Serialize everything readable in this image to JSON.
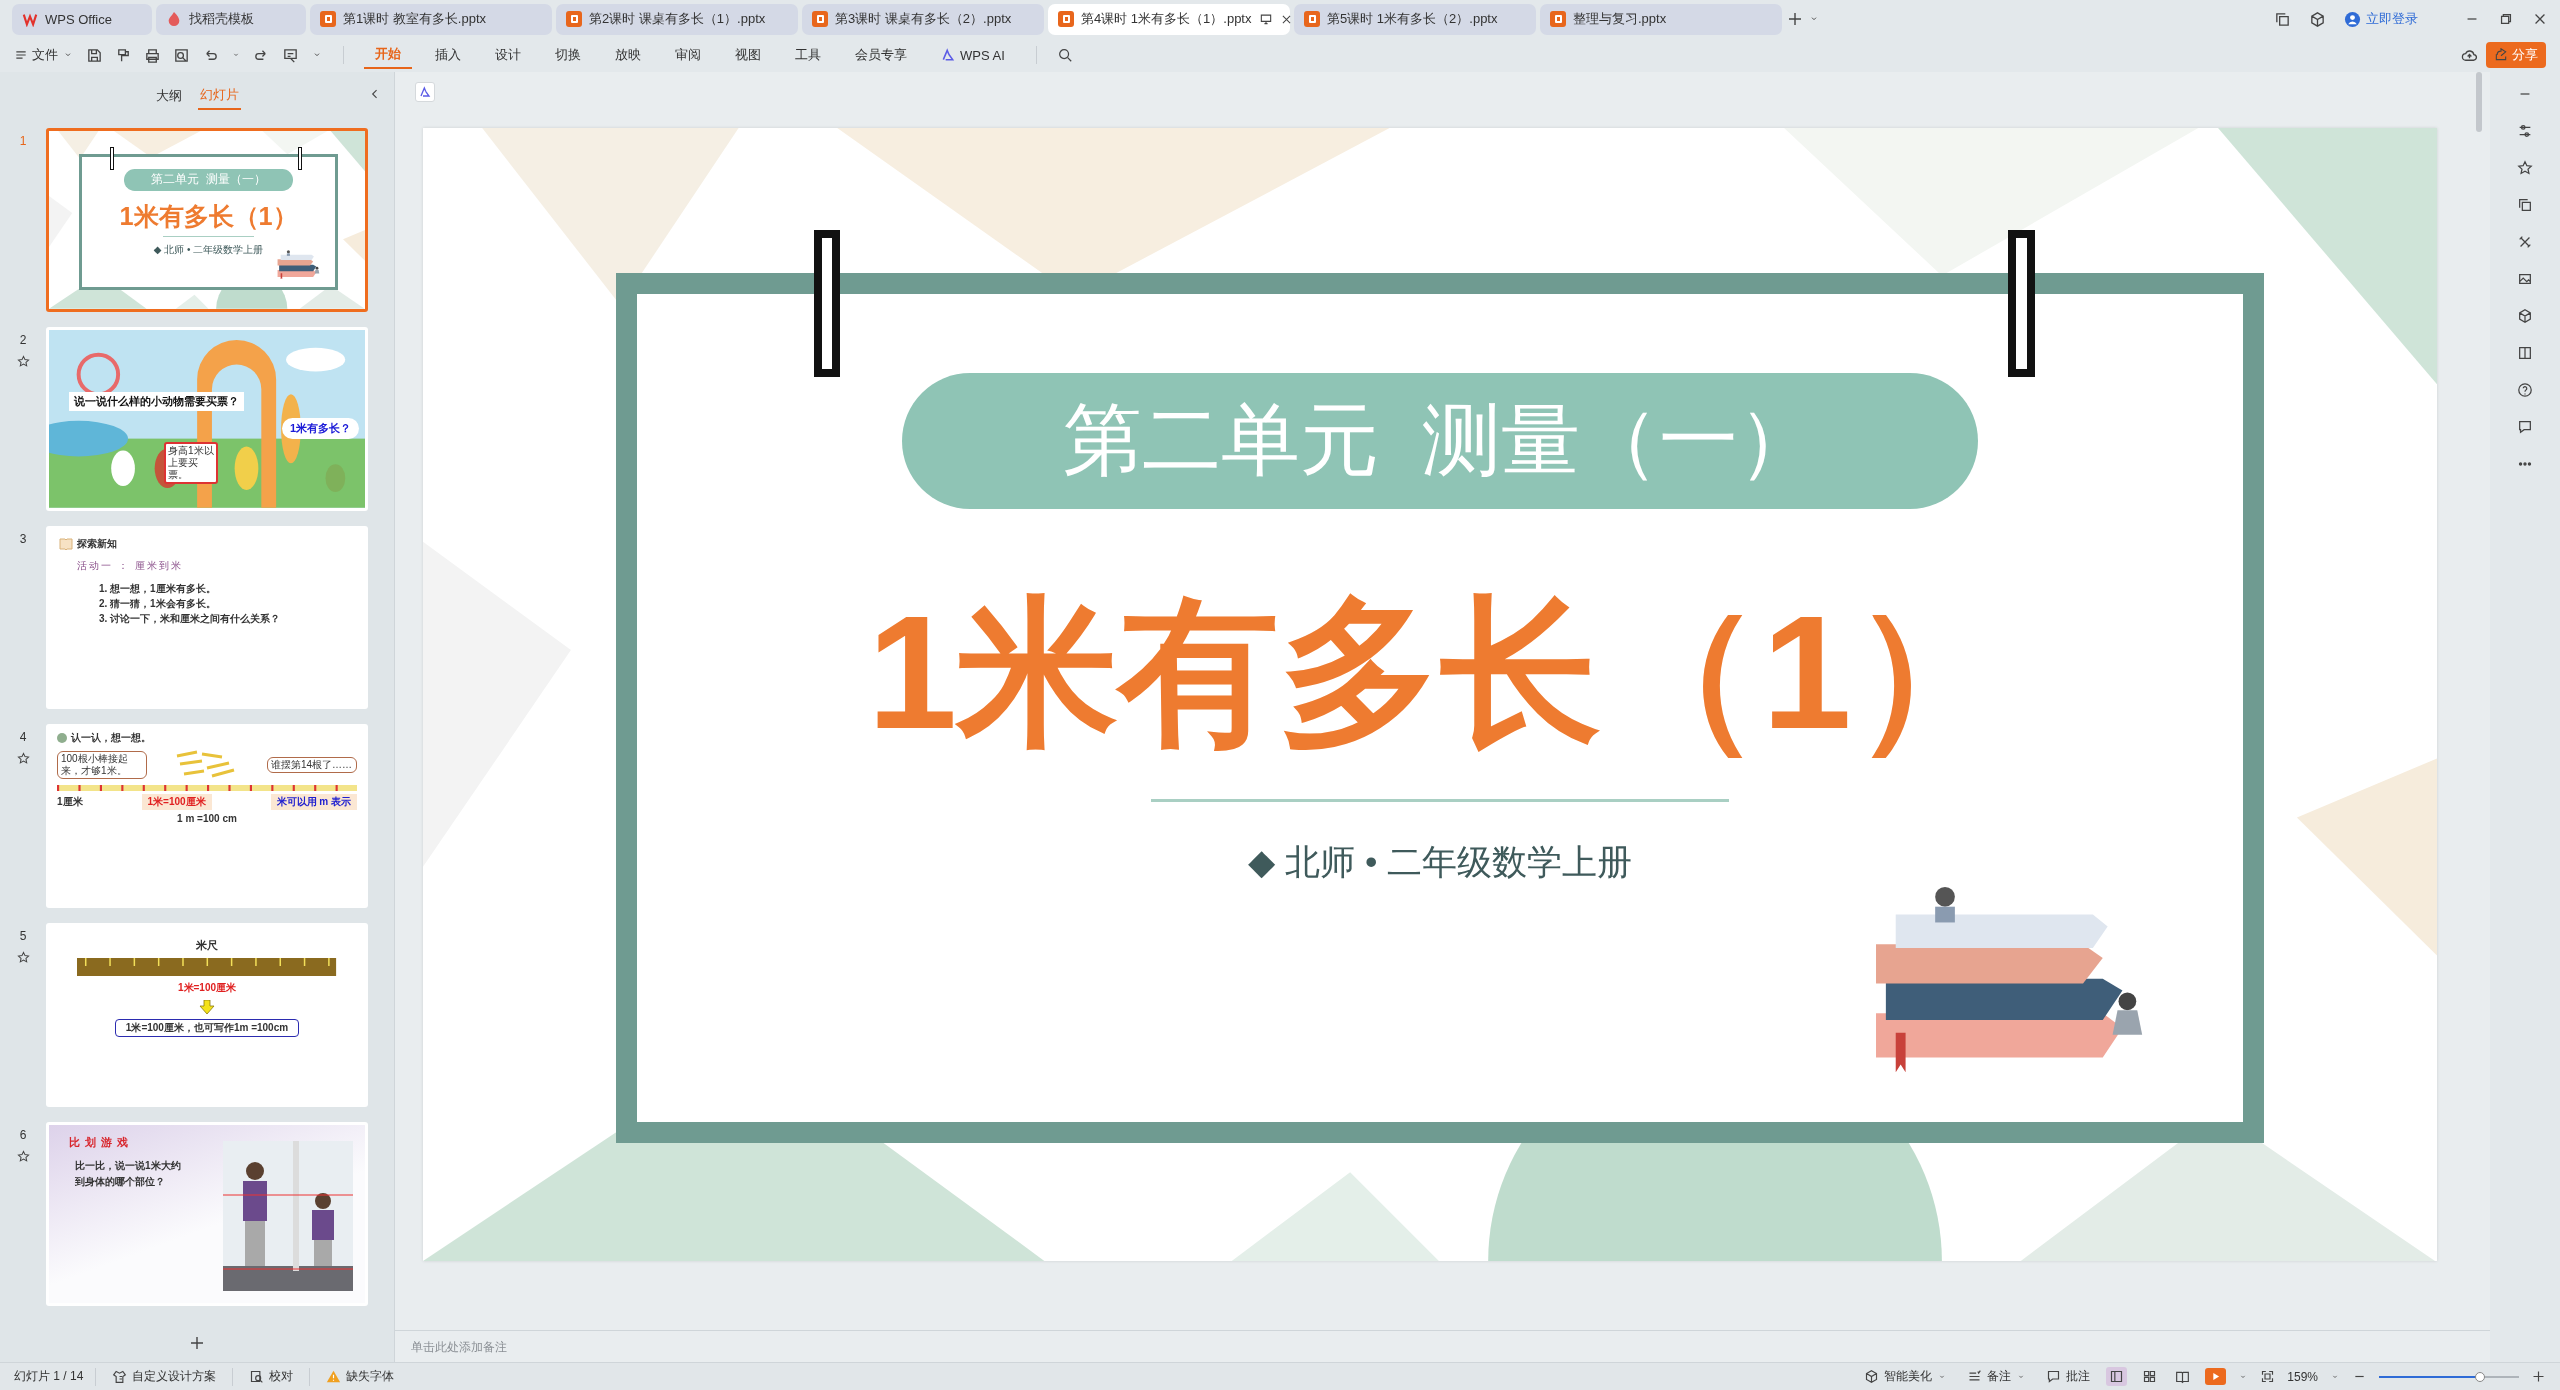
{
  "tabs": [
    {
      "label": "WPS Office",
      "kind": "home",
      "selected": false
    },
    {
      "label": "找稻壳模板",
      "kind": "template",
      "selected": false
    },
    {
      "label": "第1课时 教室有多长.pptx",
      "kind": "document",
      "selected": false
    },
    {
      "label": "第2课时 课桌有多长（1）.pptx",
      "kind": "document",
      "selected": false
    },
    {
      "label": "第3课时 课桌有多长（2）.pptx",
      "kind": "document",
      "selected": false
    },
    {
      "label": "第4课时 1米有多长（1）.pptx",
      "kind": "document",
      "selected": true
    },
    {
      "label": "第5课时 1米有多长（2）.pptx",
      "kind": "document",
      "selected": false
    },
    {
      "label": "整理与复习.pptx",
      "kind": "document",
      "selected": false
    }
  ],
  "account": {
    "login": "立即登录"
  },
  "ribbon": {
    "file_menu": "文件",
    "tabs": [
      {
        "label": "开始",
        "kind": "text",
        "selected": true
      },
      {
        "label": "插入",
        "kind": "text",
        "selected": false
      },
      {
        "label": "设计",
        "kind": "text",
        "selected": false
      },
      {
        "label": "切换",
        "kind": "text",
        "selected": false
      },
      {
        "label": "放映",
        "kind": "text",
        "selected": false
      },
      {
        "label": "审阅",
        "kind": "text",
        "selected": false
      },
      {
        "label": "视图",
        "kind": "text",
        "selected": false
      },
      {
        "label": "工具",
        "kind": "text",
        "selected": false
      },
      {
        "label": "会员专享",
        "kind": "text",
        "selected": false
      },
      {
        "label": "WPS AI",
        "kind": "ai",
        "selected": false
      }
    ],
    "share": "分享"
  },
  "panel": {
    "tabs": [
      {
        "label": "大纲",
        "selected": false
      },
      {
        "label": "幻灯片",
        "selected": true
      }
    ],
    "slides": [
      {
        "number": "1",
        "kind": "title",
        "selected": true,
        "animated": false,
        "unit": "第二单元  测量（一）",
        "title": "1米有多长（1）",
        "subtitle": "◆ 北师 • 二年级数学上册"
      },
      {
        "number": "2",
        "kind": "scene",
        "selected": false,
        "animated": true,
        "question": "说一说什么样的小动物需要买票？",
        "sign": "身高1米以上要买票。",
        "bubble": "1米有多长？"
      },
      {
        "number": "3",
        "kind": "list",
        "selected": false,
        "animated": false,
        "heading": "探索新知",
        "activity": "活动一 ： 厘米到米",
        "items": [
          "1. 想一想，1厘米有多长。",
          "2. 猜一猜，1米会有多长。",
          "3. 讨论一下，米和厘米之间有什么关系？"
        ]
      },
      {
        "number": "4",
        "kind": "concept",
        "selected": false,
        "animated": true,
        "heading": "认一认，想一想。",
        "bubble_left": "100根小棒接起来，才够1米。",
        "bubble_right": "谁摆第14根了……",
        "unit_label": "1厘米",
        "equation": "1米=100厘米",
        "note": "米可以用 m 表示",
        "symbols": "1 m =100 cm"
      },
      {
        "number": "5",
        "kind": "ruler",
        "selected": false,
        "animated": true,
        "heading": "米尺",
        "equation": "1米=100厘米",
        "summary": "1米=100厘米，也可写作1m =100cm"
      },
      {
        "number": "6",
        "selected": false,
        "animated": true,
        "heading": "比 划 游 戏",
        "question": "比一比，说一说1米大约到身体的哪个部位？"
      }
    ]
  },
  "slide": {
    "unit": "第二单元  测量（一）",
    "title": "1米有多长（1）",
    "subtitle": "◆ 北师 • 二年级数学上册"
  },
  "notes": {
    "placeholder": "单击此处添加备注"
  },
  "status_bar": {
    "position": "幻灯片 1 / 14",
    "left_items": [
      {
        "label": "自定义设计方案",
        "kind": "design"
      },
      {
        "label": "校对",
        "kind": "proof"
      },
      {
        "label": "缺失字体",
        "kind": "warning"
      }
    ],
    "right_items": [
      {
        "label": "智能美化",
        "kind": "beautify"
      },
      {
        "label": "备注",
        "kind": "notes"
      },
      {
        "label": "批注",
        "kind": "comment"
      }
    ],
    "views": [
      {
        "kind": "normal",
        "selected": true
      },
      {
        "kind": "sorter",
        "selected": false
      },
      {
        "kind": "reading",
        "selected": false
      }
    ],
    "zoom": "159%",
    "zoom_slider": {
      "level": 0.72
    }
  }
}
